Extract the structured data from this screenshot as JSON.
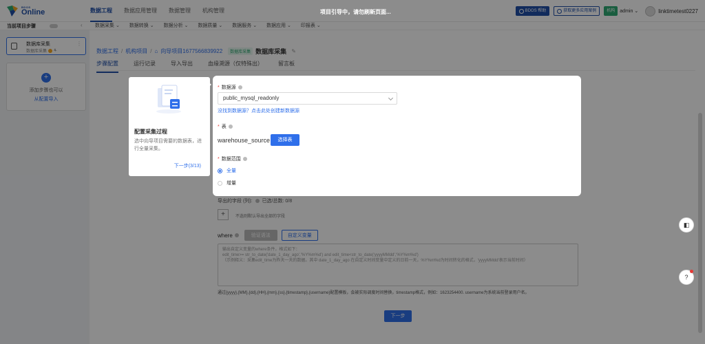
{
  "brand": {
    "small": "BDOS",
    "name": "Online"
  },
  "nav": [
    {
      "label": "数据工程",
      "active": true
    },
    {
      "label": "数据应用管理",
      "active": false
    },
    {
      "label": "数据管理",
      "active": false
    },
    {
      "label": "机构管理",
      "active": false
    }
  ],
  "banner": "项目引导中，请勿刷新页面...",
  "topright": {
    "btn1": "BDOS 帮助",
    "btn2": "获取更多应用案例",
    "org": "机构",
    "user_select": "admin",
    "user_name": "linktimetest0227"
  },
  "subbar": {
    "project_label": "当前项目步骤",
    "items": [
      "数据采集",
      "数据转换",
      "数据分析",
      "数据质量",
      "数据服务",
      "数据应用",
      "印报表"
    ]
  },
  "sidebar": {
    "step_title": "数据库采集",
    "step_sub": "数据库采集",
    "add_text": "添加步骤也可以",
    "add_link": "从配置导入"
  },
  "breadcrumb": {
    "part1": "数据工程",
    "part2": "机构项目",
    "part3": "向导项目1677566839922",
    "tag": "数据库采集",
    "current": "数据库采集"
  },
  "tabs": [
    "步骤配置",
    "运行记录",
    "导入导出",
    "血缘溯源（仅特殊出）",
    "留言板"
  ],
  "guide": {
    "title": "配置采集过程",
    "desc": "选中向导项目需要的数据表，进行全量采集。",
    "next": "下一步(3/13)"
  },
  "form": {
    "datasource_label": "数据源",
    "datasource_value": "public_mysql_readonly",
    "datasource_link": "没找到数据源？点击此处创建新数据源",
    "table_label": "表",
    "table_value": "warehouse_source",
    "select_table_btn": "选择表",
    "range_label": "数据范围",
    "range_options": [
      {
        "label": "全量",
        "checked": true
      },
      {
        "label": "增量",
        "checked": false
      }
    ]
  },
  "background": {
    "export_fields": "导出的字段 (列):",
    "selected_count": "已选/总数: 0/8",
    "plus_note": "不选则默认导出全部的字段",
    "where_label": "where",
    "where_btn1": "验证语法",
    "where_btn2": "自定义变量",
    "where_placeholder": "输出自定义变量的where条件，格式如下：\nedit_time>= str_to_date('date_1_day_ago','%Y%m%d') and edit_time<str_to_date('yyyyMMdd','%Y%m%d')\n（示例释义：采集edit_time为昨天一天的数据。其中 date_1_day_ago 在自定义时间变量中定义的日前一天，%Y%m%d为时间转化的格式，'yyyyMMdd'表示当前时间）",
    "where_help": "通过{yyyy},{MM},{dd},{HH},{mm},{ss},{timestamp},{username}配置模板，会被实际调度时间替换，timestamp格式，例如：1623254400. username为系统当前登录用户名。",
    "next_btn": "下一步"
  },
  "colors": {
    "accent": "#2f6fea",
    "brand": "#1f4fa8",
    "success": "#2eaa73"
  }
}
